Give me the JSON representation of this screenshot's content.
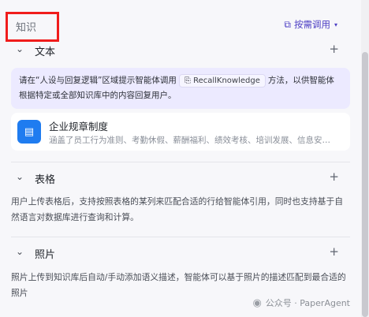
{
  "header": {
    "title": "知识",
    "on_demand_label": "按需调用",
    "on_demand_icon": "puzzle-icon",
    "caret_icon": "caret-down-icon"
  },
  "groups": {
    "text": {
      "label": "文本",
      "tip_part1": "请在“人设与回复逻辑”区域提示智能体调用",
      "tip_code": "RecallKnowledge",
      "tip_part2": "方法，以供智能体根据特定或全部知识库中的内容回复用户。",
      "kb_title": "企业规章制度",
      "kb_desc": "涵盖了员工行为准则、考勤休假、薪酬福利、绩效考核、培训发展、信息安…"
    },
    "table": {
      "label": "表格",
      "desc": "用户上传表格后，支持按照表格的某列来匹配合适的行给智能体引用，同时也支持基于自然语言对数据库进行查询和计算。"
    },
    "photo": {
      "label": "照片",
      "desc": "照片上传到知识库后自动/手动添加语义描述，智能体可以基于照片的描述匹配到最合适的照片"
    }
  },
  "icons": {
    "chevron": "chevron-down-icon",
    "plus": "plus-icon",
    "kb": "document-icon"
  },
  "watermark": {
    "account": "公众号 · PaperAgent"
  },
  "colors": {
    "accent": "#4d3fc4",
    "highlight_border": "#f01c1c",
    "tip_bg": "#eceaff",
    "kb_icon_bg": "#1f7cf0"
  }
}
